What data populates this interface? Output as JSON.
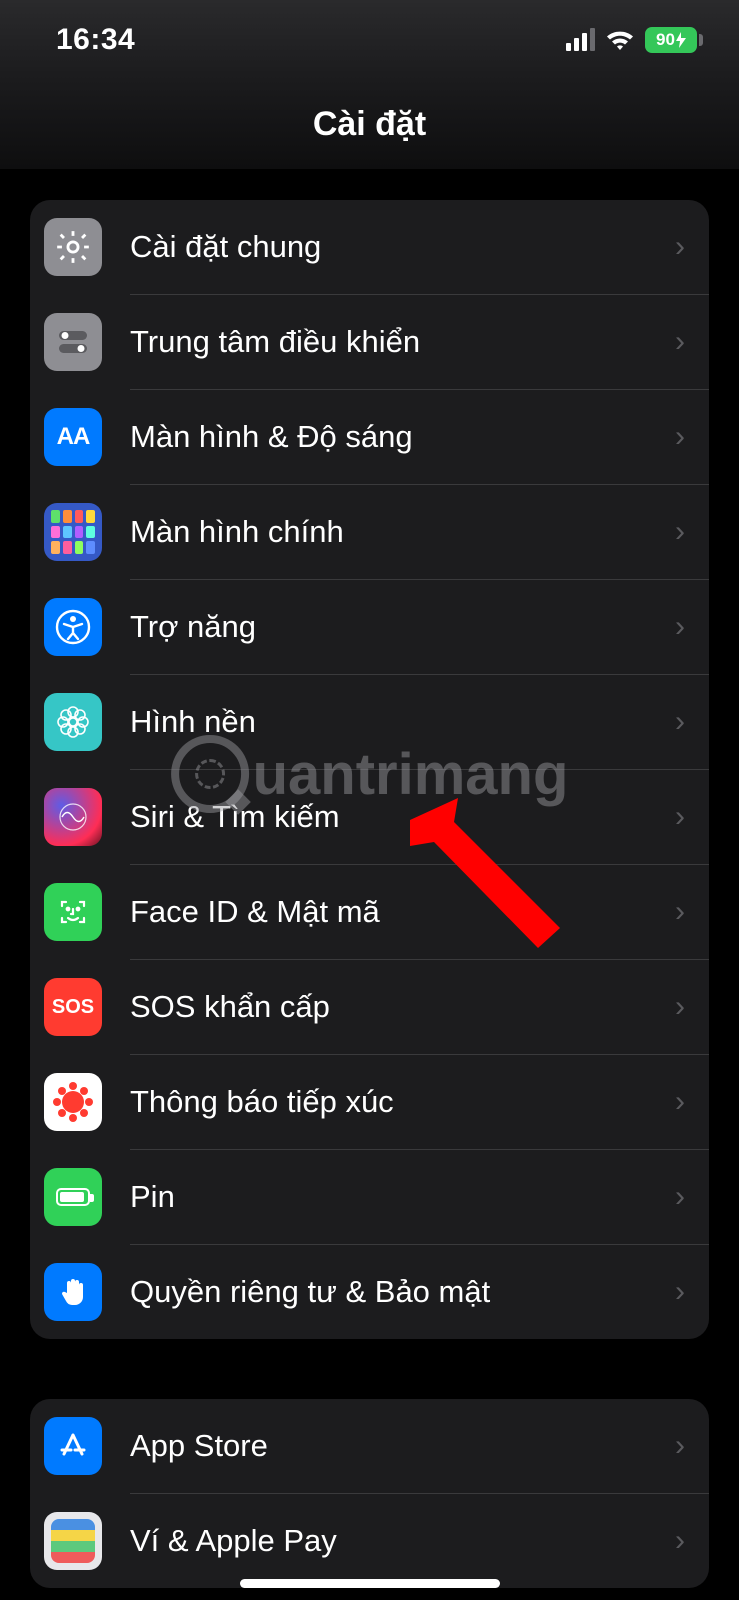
{
  "status": {
    "time": "16:34",
    "battery_percent": "90"
  },
  "header": {
    "title": "Cài đặt"
  },
  "watermark": {
    "text": "uantrimang"
  },
  "groups": [
    {
      "items": [
        {
          "key": "general",
          "label": "Cài đặt chung"
        },
        {
          "key": "control",
          "label": "Trung tâm điều khiển"
        },
        {
          "key": "display",
          "label": "Màn hình & Độ sáng"
        },
        {
          "key": "home",
          "label": "Màn hình chính"
        },
        {
          "key": "accessibility",
          "label": "Trợ năng"
        },
        {
          "key": "wallpaper",
          "label": "Hình nền"
        },
        {
          "key": "siri",
          "label": "Siri & Tìm kiếm"
        },
        {
          "key": "faceid",
          "label": "Face ID & Mật mã"
        },
        {
          "key": "sos",
          "label": "SOS khẩn cấp"
        },
        {
          "key": "exposure",
          "label": "Thông báo tiếp xúc"
        },
        {
          "key": "battery",
          "label": "Pin"
        },
        {
          "key": "privacy",
          "label": "Quyền riêng tư & Bảo mật"
        }
      ]
    },
    {
      "items": [
        {
          "key": "appstore",
          "label": "App Store"
        },
        {
          "key": "wallet",
          "label": "Ví & Apple Pay"
        }
      ]
    }
  ],
  "icon_text": {
    "display": "AA",
    "sos": "SOS"
  }
}
